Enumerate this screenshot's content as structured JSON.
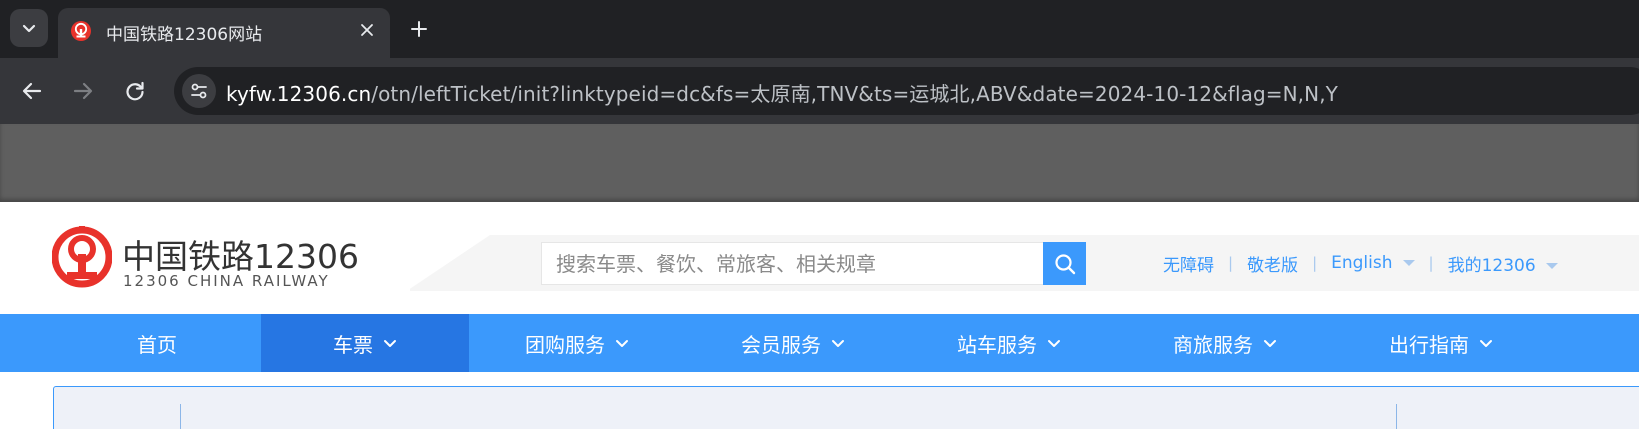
{
  "browser": {
    "tab": {
      "title": "中国铁路12306网站"
    },
    "url": {
      "host": "kyfw.12306.cn",
      "path": "/otn/leftTicket/init?linktypeid=dc&fs=太原南,TNV&ts=运城北,ABV&date=2024-10-12&flag=N,N,Y"
    },
    "icons": {
      "tab_search": "chevron-down-icon",
      "close": "close-icon",
      "new_tab": "plus-icon",
      "back": "arrow-left-icon",
      "forward": "arrow-right-icon",
      "reload": "reload-icon",
      "site_info": "tune-icon"
    }
  },
  "header": {
    "logo_cn": "中国铁路12306",
    "logo_en": "12306 CHINA RAILWAY",
    "search": {
      "placeholder": "搜索车票、餐饮、常旅客、相关规章"
    },
    "links": {
      "accessibility": "无障碍",
      "elderly": "敬老版",
      "language": "English",
      "my12306": "我的12306"
    }
  },
  "nav": {
    "items": [
      {
        "label": "首页",
        "dropdown": false,
        "active": false
      },
      {
        "label": "车票",
        "dropdown": true,
        "active": true
      },
      {
        "label": "团购服务",
        "dropdown": true,
        "active": false
      },
      {
        "label": "会员服务",
        "dropdown": true,
        "active": false
      },
      {
        "label": "站车服务",
        "dropdown": true,
        "active": false
      },
      {
        "label": "商旅服务",
        "dropdown": true,
        "active": false
      },
      {
        "label": "出行指南",
        "dropdown": true,
        "active": false
      }
    ]
  },
  "colors": {
    "brand_blue": "#3b99fc",
    "nav_active": "#2676e3",
    "logo_red": "#e8322b",
    "chrome_dark": "#202124"
  }
}
